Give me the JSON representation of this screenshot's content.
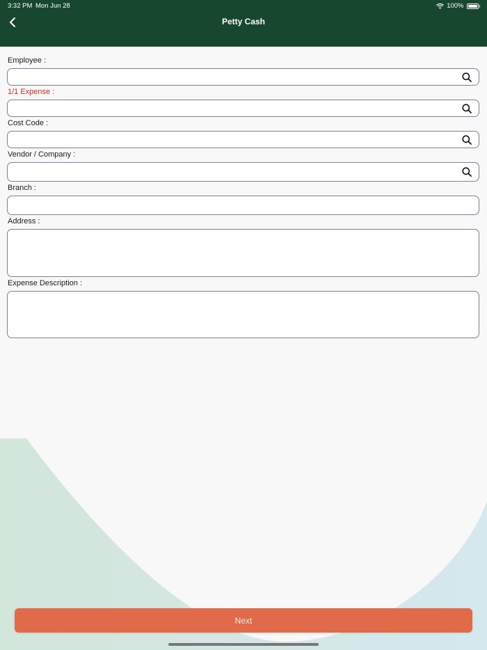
{
  "status_bar": {
    "time": "3:32 PM",
    "date": "Mon Jun 28",
    "battery": "100%"
  },
  "header": {
    "title": "Petty Cash"
  },
  "form": {
    "employee": {
      "label": "Employee :",
      "value": ""
    },
    "expense": {
      "label": "1/1 Expense :",
      "value": ""
    },
    "cost_code": {
      "label": "Cost Code :",
      "value": ""
    },
    "vendor": {
      "label": "Vendor / Company :",
      "value": ""
    },
    "branch": {
      "label": "Branch :",
      "value": ""
    },
    "address": {
      "label": "Address :",
      "value": ""
    },
    "description": {
      "label": "Expense Description :",
      "value": ""
    }
  },
  "footer": {
    "next_label": "Next"
  },
  "colors": {
    "header": "#17472f",
    "accent_button": "#e06b4a",
    "required_label": "#e02525",
    "field_border": "#7b7ea3"
  },
  "icons": [
    "back-icon",
    "wifi-icon",
    "battery-icon",
    "search-icon"
  ]
}
